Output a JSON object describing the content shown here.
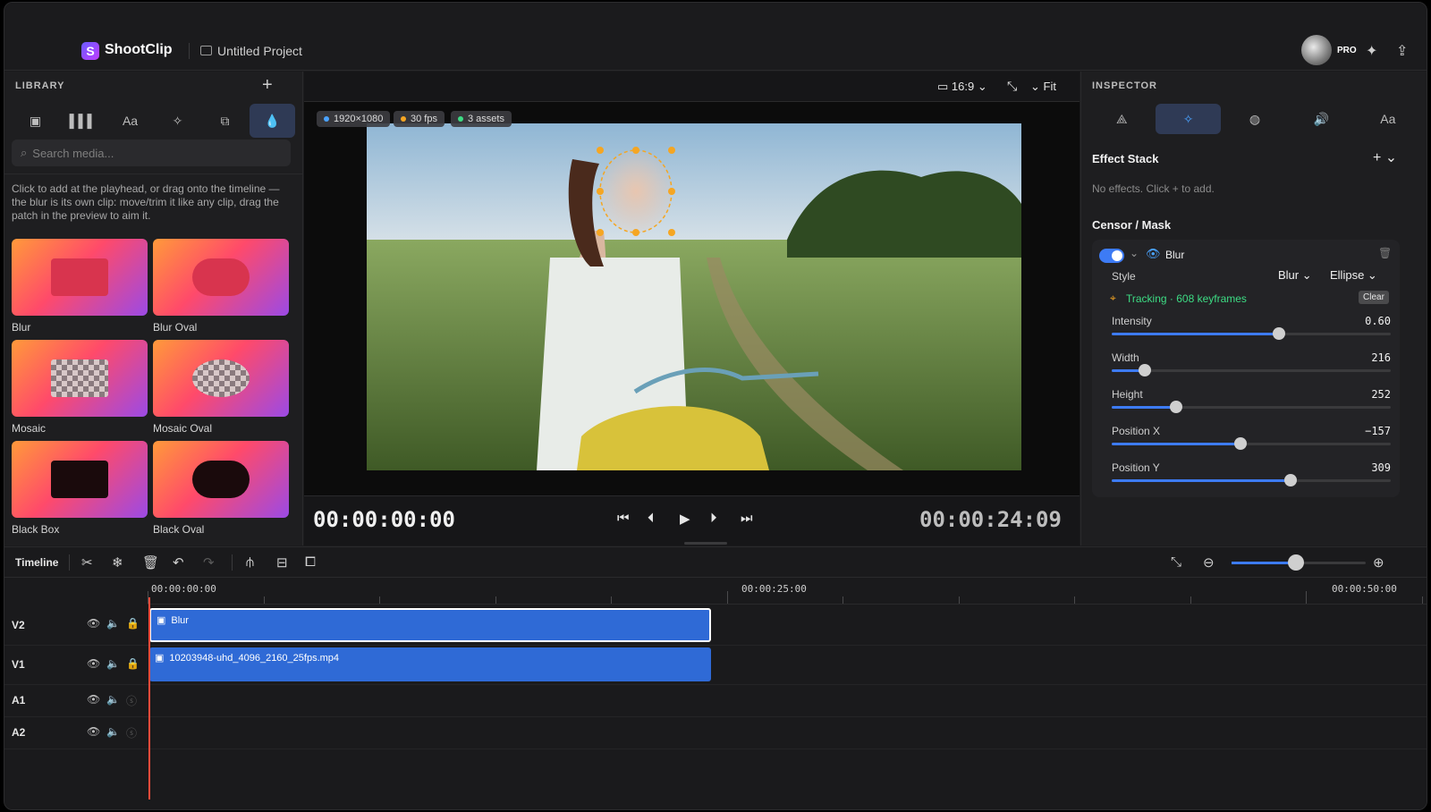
{
  "app": {
    "name": "ShootClip",
    "logo_letter": "S",
    "project": "Untitled Project",
    "plan_badge": "PRO"
  },
  "library": {
    "title": "LIBRARY",
    "tabs": [
      "media-icon",
      "audio-icon",
      "Aa",
      "effects-icon",
      "shapes-icon",
      "censor-icon"
    ],
    "search_placeholder": "Search media...",
    "help": "Click to add at the playhead, or drag onto the timeline — the blur is its own clip: move/trim it like any clip, drag the patch in the preview to aim it.",
    "items": [
      {
        "label": "Blur",
        "kind": "blur-rect"
      },
      {
        "label": "Blur Oval",
        "kind": "blur-oval"
      },
      {
        "label": "Mosaic",
        "kind": "mosaic-rect"
      },
      {
        "label": "Mosaic Oval",
        "kind": "mosaic-oval"
      },
      {
        "label": "Black Box",
        "kind": "black-rect"
      },
      {
        "label": "Black Oval",
        "kind": "black-oval"
      }
    ]
  },
  "preview": {
    "aspect": "16:9",
    "fit": "Fit",
    "chips": [
      {
        "text": "1920×1080",
        "color": "#4aa3ff"
      },
      {
        "text": "30 fps",
        "color": "#f5a623"
      },
      {
        "text": "3 assets",
        "color": "#3ddc84"
      }
    ],
    "current_time": "00:00:00:00",
    "duration": "00:00:24:09"
  },
  "inspector": {
    "title": "INSPECTOR",
    "tabs": [
      "transform-icon",
      "effects-icon",
      "color-icon",
      "audio-icon",
      "Aa"
    ],
    "effect_stack": {
      "title": "Effect Stack",
      "empty": "No effects. Click + to add."
    },
    "censor": {
      "title": "Censor / Mask",
      "name": "Blur",
      "style_label": "Style",
      "style_value": "Blur",
      "shape_value": "Ellipse",
      "tracking": "Tracking · 608 keyframes",
      "clear": "Clear",
      "sliders": [
        {
          "name": "Intensity",
          "value": "0.60",
          "fraction": 0.6
        },
        {
          "name": "Width",
          "value": "216",
          "fraction": 0.12
        },
        {
          "name": "Height",
          "value": "252",
          "fraction": 0.23
        },
        {
          "name": "Position X",
          "value": "−157",
          "fraction": 0.46
        },
        {
          "name": "Position Y",
          "value": "309",
          "fraction": 0.64
        }
      ]
    }
  },
  "timeline": {
    "title": "Timeline",
    "ruler": [
      "00:00:00:00",
      "00:00:25:00",
      "00:00:50:00"
    ],
    "tracks": [
      {
        "name": "V2",
        "clip": "Blur"
      },
      {
        "name": "V1",
        "clip": "10203948-uhd_4096_2160_25fps.mp4"
      },
      {
        "name": "A1",
        "clip": ""
      },
      {
        "name": "A2",
        "clip": ""
      }
    ],
    "zoom_fraction": 0.48
  },
  "colors": {
    "accent": "#3d7bf5",
    "playhead": "#ff4b3a",
    "tracking": "#3ddc84",
    "handle": "#f5a623"
  }
}
